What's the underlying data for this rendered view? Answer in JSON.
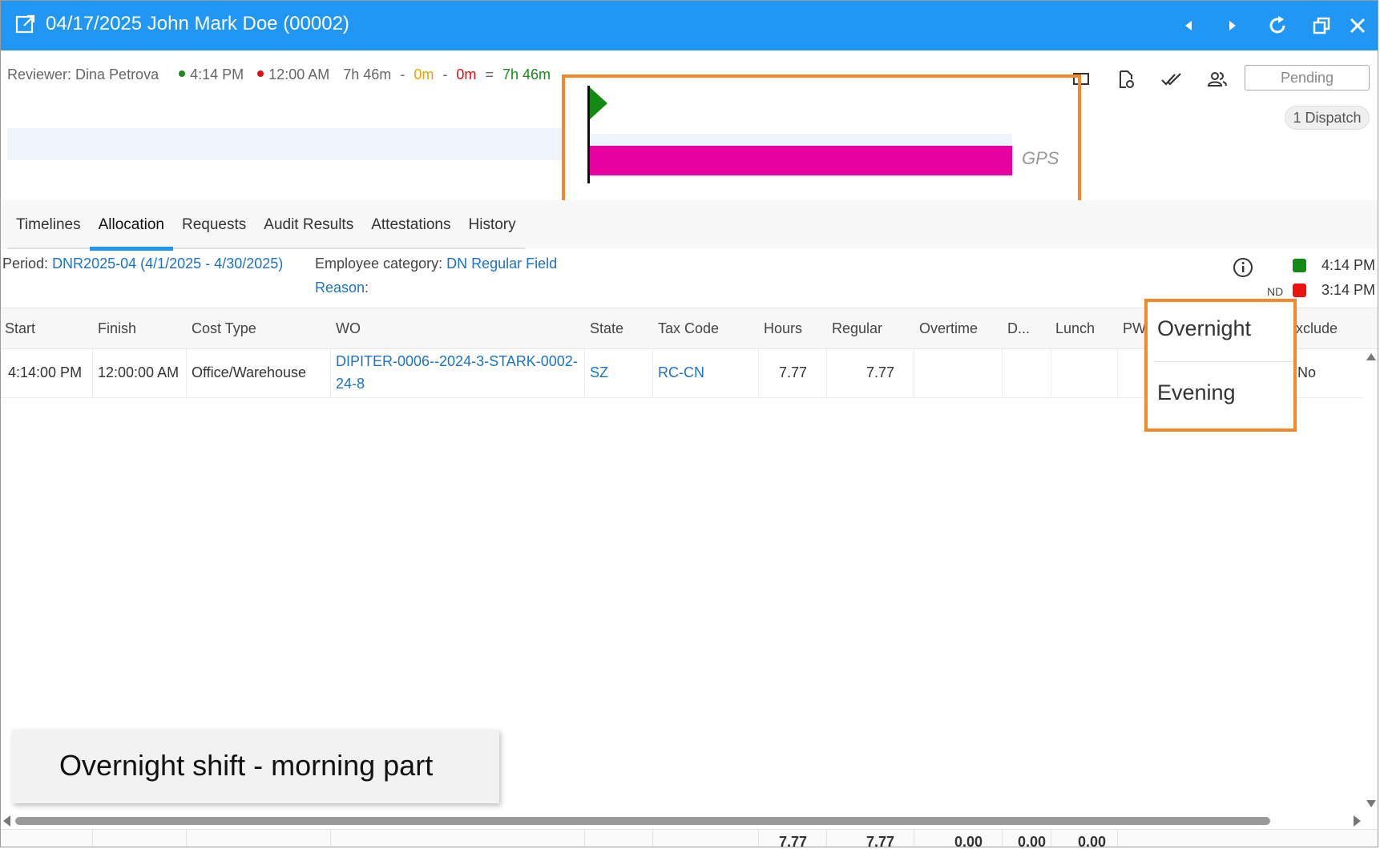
{
  "window": {
    "title": "04/17/2025 John Mark Doe (00002)",
    "title_bg": "#2196f3"
  },
  "header": {
    "reviewer": "Reviewer: Dina Petrova",
    "start_time": "4:14 PM",
    "end_time": "12:00 AM",
    "duration": "7h 46m",
    "dash1": "-",
    "minus_a": "0m",
    "dash2": "-",
    "minus_b": "0m",
    "equals": "=",
    "total": "7h 46m",
    "status": "Pending",
    "dispatch": "1 Dispatch"
  },
  "timeline": {
    "gps_label": "GPS",
    "bar_color": "#e800a0",
    "flag_color": "#138a13"
  },
  "tabs": [
    {
      "label": "Timelines"
    },
    {
      "label": "Allocation"
    },
    {
      "label": "Requests"
    },
    {
      "label": "Audit Results"
    },
    {
      "label": "Attestations"
    },
    {
      "label": "History"
    }
  ],
  "active_tab": "Allocation",
  "period": {
    "label": "Period:",
    "value": "DNR2025-04 (4/1/2025 - 4/30/2025)",
    "emp_cat_label": "Employee category:",
    "emp_cat_value": "DN Regular Field",
    "reason_label": "Reason",
    "reason_colon": ":"
  },
  "legend": {
    "green_time": "4:14 PM",
    "red_time": "3:14 PM",
    "nd": "ND"
  },
  "grid": {
    "headers": [
      "Start",
      "Finish",
      "Cost Type",
      "WO",
      "State",
      "Tax Code",
      "Hours",
      "Regular",
      "Overtime",
      "D...",
      "Lunch",
      "PW",
      "xclude"
    ],
    "row": {
      "start": "4:14:00 PM",
      "finish": "12:00:00 AM",
      "cost_type": "Office/Warehouse",
      "wo": "DIPITER-0006--2024-3-STARK-0002-24-8",
      "state": "SZ",
      "tax_code": "RC-CN",
      "hours": "7.77",
      "regular": "7.77",
      "exclude": "No"
    },
    "totals": {
      "hours": "7.77",
      "regular": "7.77",
      "overtime": "0.00",
      "d": "0.00",
      "lunch": "0.00"
    }
  },
  "dropdown": {
    "options": [
      "Overnight",
      "Evening"
    ]
  },
  "note": "Overnight shift - morning part"
}
